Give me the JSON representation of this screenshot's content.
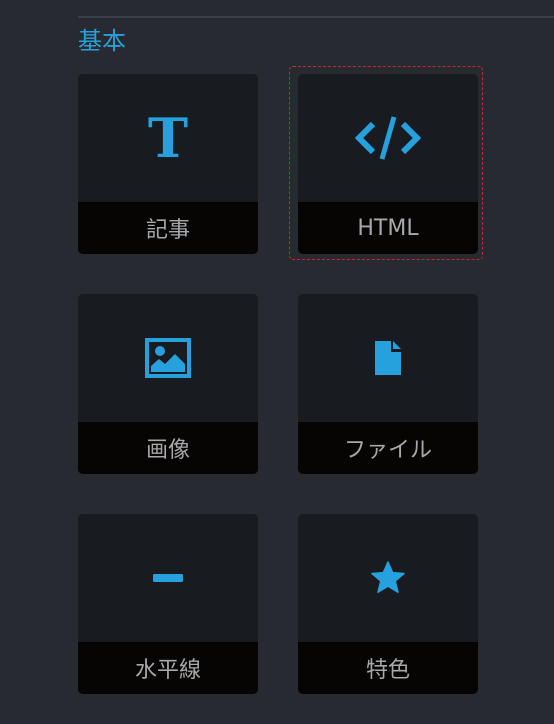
{
  "section": {
    "title": "基本"
  },
  "blocks": [
    {
      "label": "記事",
      "icon": "text-icon",
      "glyph": "T"
    },
    {
      "label": "HTML",
      "icon": "code-icon"
    },
    {
      "label": "画像",
      "icon": "image-icon"
    },
    {
      "label": "ファイル",
      "icon": "file-icon"
    },
    {
      "label": "水平線",
      "icon": "horizontal-line-icon"
    },
    {
      "label": "特色",
      "icon": "star-icon"
    }
  ],
  "selected_block": "HTML",
  "colors": {
    "accent": "#27a1de",
    "background": "#272a30",
    "tile": "#181c21",
    "label_bar": "#070504",
    "label_text": "#a6a8ab",
    "selection": "#c8282d"
  }
}
